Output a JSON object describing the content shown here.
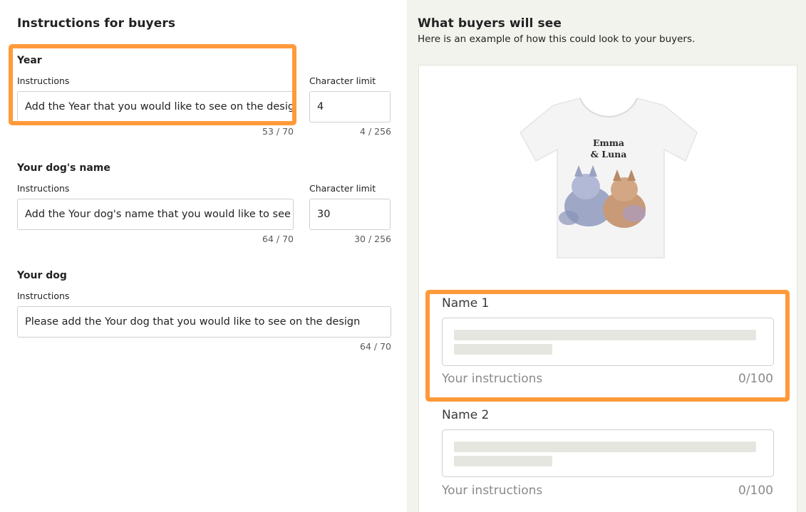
{
  "left": {
    "title": "Instructions for buyers",
    "fields": [
      {
        "name": "Year",
        "instructions_label": "Instructions",
        "instructions_value": "Add the Year that you would like to see on the design",
        "instructions_count": "53 / 70",
        "limit_label": "Character limit",
        "limit_value": "4",
        "limit_count": "4 / 256"
      },
      {
        "name": "Your dog's name",
        "instructions_label": "Instructions",
        "instructions_value": "Add the Your dog's name that you would like to see on the design",
        "instructions_count": "64 / 70",
        "limit_label": "Character limit",
        "limit_value": "30",
        "limit_count": "30 / 256"
      },
      {
        "name": "Your dog",
        "instructions_label": "Instructions",
        "instructions_value": "Please add the Your dog that you would like to see on the design",
        "instructions_count": "64 / 70"
      }
    ]
  },
  "right": {
    "title": "What buyers will see",
    "subtitle": "Here is an example of how this could look to your buyers.",
    "shirt_text_line1": "Emma",
    "shirt_text_line2": "& Luna",
    "previews": [
      {
        "label": "Name 1",
        "instructions": "Your instructions",
        "count": "0/100"
      },
      {
        "label": "Name 2",
        "instructions": "Your instructions",
        "count": "0/100"
      }
    ]
  },
  "colors": {
    "highlight": "#ff9a3a",
    "right_bg": "#f3f3ee",
    "skeleton": "#e6e6e1"
  }
}
